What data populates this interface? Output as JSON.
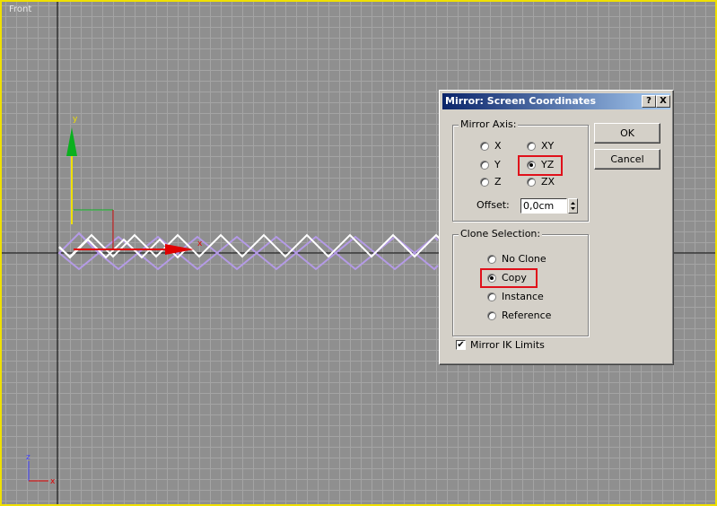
{
  "viewport": {
    "label": "Front"
  },
  "gizmo": {
    "y_label": "y",
    "x_label": "x"
  },
  "corner_axes": {
    "z_label": "z",
    "x_label": "x"
  },
  "dialog": {
    "title": "Mirror: Screen Coordinates",
    "help_button": "?",
    "close_button": "X",
    "mirror_axis": {
      "label": "Mirror Axis:",
      "options": [
        "X",
        "Y",
        "Z",
        "XY",
        "YZ",
        "ZX"
      ],
      "selected": "YZ",
      "offset_label": "Offset:",
      "offset_value": "0,0cm"
    },
    "clone_selection": {
      "label": "Clone Selection:",
      "options": [
        "No Clone",
        "Copy",
        "Instance",
        "Reference"
      ],
      "selected": "Copy"
    },
    "mirror_ik": {
      "label": "Mirror IK Limits",
      "checked": true
    },
    "ok_button": "OK",
    "cancel_button": "Cancel"
  },
  "colors": {
    "viewport_border": "#f0e000",
    "viewport_bg": "#8f8f8f",
    "spring_original": "#ffffff",
    "spring_mirror": "#b49ae6",
    "highlight": "#e0101a"
  }
}
